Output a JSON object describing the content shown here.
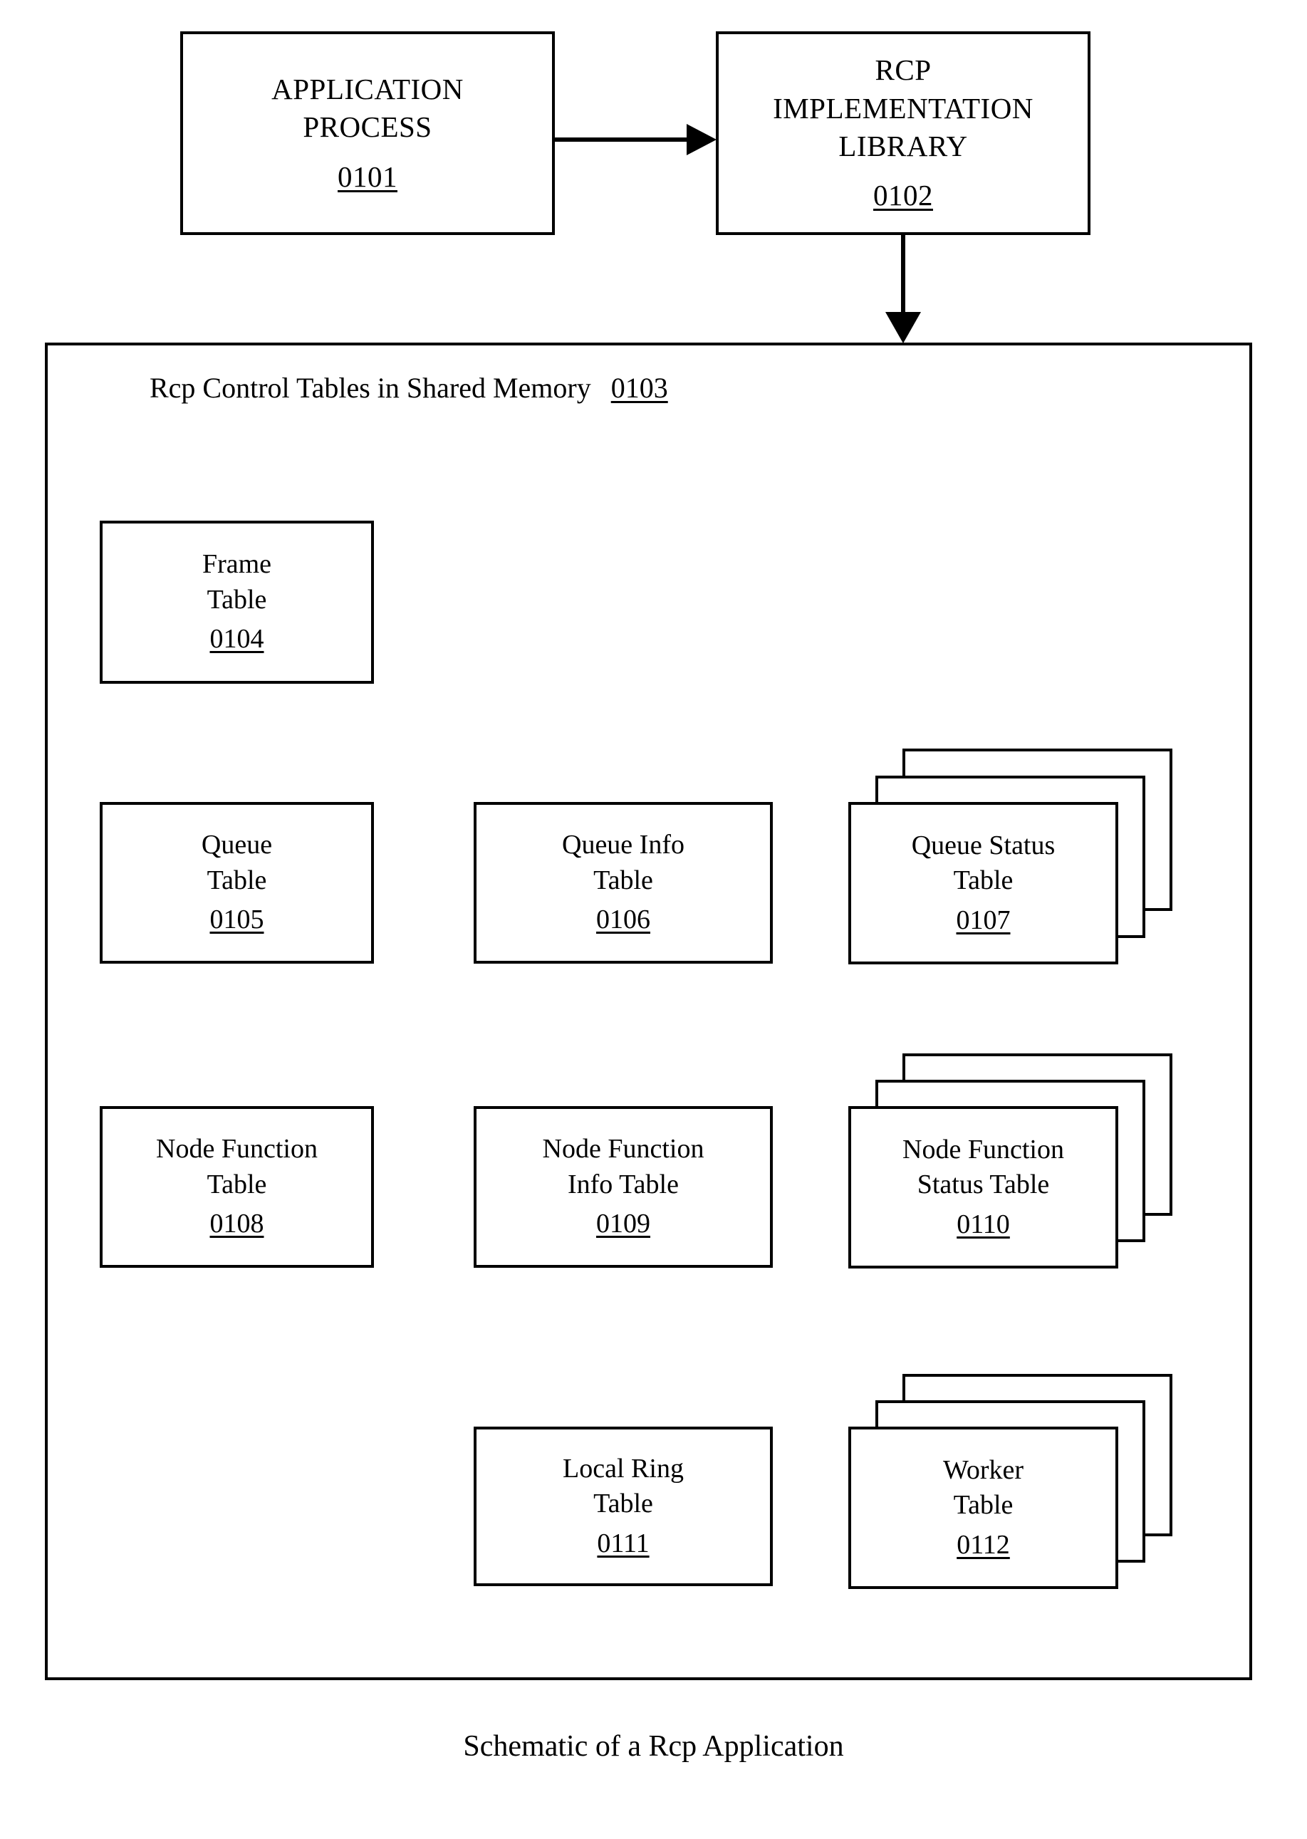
{
  "figure": {
    "caption": "Schematic of a Rcp Application"
  },
  "top_row": {
    "application_process": {
      "line1": "APPLICATION",
      "line2": "PROCESS",
      "ref": "0101"
    },
    "rcp_library": {
      "line1": "RCP",
      "line2": "IMPLEMENTATION",
      "line3": "LIBRARY",
      "ref": "0102"
    }
  },
  "arrows": {
    "app_to_library": "arrow-right",
    "library_to_shared_memory": "arrow-down"
  },
  "shared_memory": {
    "title": "Rcp Control Tables in Shared Memory",
    "ref": "0103",
    "tables": {
      "frame_table": {
        "line1": "Frame",
        "line2": "Table",
        "ref": "0104",
        "stacked": false
      },
      "queue_table": {
        "line1": "Queue",
        "line2": "Table",
        "ref": "0105",
        "stacked": false
      },
      "queue_info_table": {
        "line1": "Queue Info",
        "line2": "Table",
        "ref": "0106",
        "stacked": false
      },
      "queue_status_table": {
        "line1": "Queue Status",
        "line2": "Table",
        "ref": "0107",
        "stacked": true
      },
      "node_function_table": {
        "line1": "Node Function",
        "line2": "Table",
        "ref": "0108",
        "stacked": false
      },
      "node_function_info_table": {
        "line1": "Node Function",
        "line2": "Info Table",
        "ref": "0109",
        "stacked": false
      },
      "node_function_status_table": {
        "line1": "Node Function",
        "line2": "Status Table",
        "ref": "0110",
        "stacked": true
      },
      "local_ring_table": {
        "line1": "Local Ring",
        "line2": "Table",
        "ref": "0111",
        "stacked": false
      },
      "worker_table": {
        "line1": "Worker",
        "line2": "Table",
        "ref": "0112",
        "stacked": true
      }
    }
  },
  "colors": {
    "stroke": "#000000",
    "background": "#ffffff"
  }
}
